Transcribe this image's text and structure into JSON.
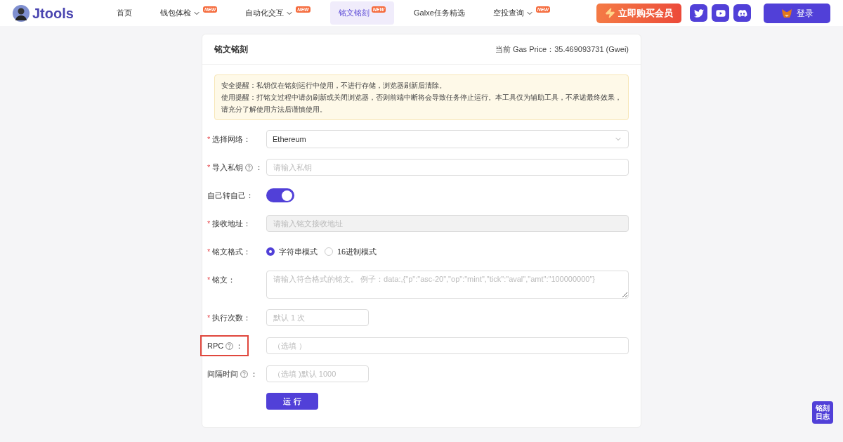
{
  "brand": {
    "name": "Jtools"
  },
  "nav": [
    {
      "label": "首页",
      "dropdown": false,
      "selected": false
    },
    {
      "label": "钱包体检",
      "dropdown": true,
      "new_badge": "NEW",
      "selected": false
    },
    {
      "label": "自动化交互",
      "dropdown": true,
      "new_badge": "NEW",
      "selected": false
    },
    {
      "label": "铭文铭刻",
      "dropdown": false,
      "new_badge": "NEW",
      "selected": true
    },
    {
      "label": "Galxe任务精选",
      "dropdown": false,
      "selected": false
    },
    {
      "label": "空投查询",
      "dropdown": true,
      "new_badge": "NEW",
      "selected": false
    }
  ],
  "buy_button": "立即购买会员",
  "social": [
    {
      "kind": "twitter"
    },
    {
      "kind": "youtube"
    },
    {
      "kind": "discord"
    }
  ],
  "login_button": "登录",
  "card": {
    "title": "铭文铭刻",
    "gas_price": "当前 Gas Price：35.469093731 (Gwei)",
    "notice": [
      "安全提醒：私钥仅在铭刻运行中使用，不进行存储，浏览器刷新后清除。",
      "使用提醒：打铭文过程中请勿刷新或关闭浏览器，否则前端中断将会导致任务停止运行。本工具仅为辅助工具，不承诺最终效果，请充分了解使用方法后谨慎使用。"
    ],
    "fields": [
      {
        "kind": "select",
        "required_mark": "*",
        "label": "选择网络",
        "colon": "：",
        "help": false,
        "highlighted": false,
        "value": "Ethereum"
      },
      {
        "kind": "input",
        "required_mark": "*",
        "label": "导入私钥",
        "colon": "：",
        "help": true,
        "highlighted": false,
        "placeholder": "请输入私钥",
        "short": false,
        "disabled": false
      },
      {
        "kind": "toggle",
        "label": "自己转自己",
        "colon": "：",
        "help": false,
        "highlighted": false,
        "on": true
      },
      {
        "kind": "input",
        "required_mark": "*",
        "label": "接收地址",
        "colon": "：",
        "help": false,
        "highlighted": false,
        "placeholder": "请输入铭文接收地址",
        "short": false,
        "disabled": true
      },
      {
        "kind": "radio",
        "required_mark": "*",
        "label": "铭文格式",
        "colon": "：",
        "help": false,
        "highlighted": false,
        "options": [
          {
            "label": "字符串模式",
            "selected": true
          },
          {
            "label": "16进制模式",
            "selected": false
          }
        ]
      },
      {
        "kind": "textarea",
        "required_mark": "*",
        "label": "铭文",
        "colon": "：",
        "help": false,
        "highlighted": false,
        "placeholder": "请输入符合格式的铭文。 例子：data:,{\"p\":\"asc-20\",\"op\":\"mint\",\"tick\":\"aval\",\"amt\":\"100000000\"}"
      },
      {
        "kind": "input",
        "required_mark": "*",
        "label": "执行次数",
        "colon": "：",
        "help": false,
        "highlighted": false,
        "placeholder": "默认 1 次",
        "short": true,
        "disabled": false
      },
      {
        "kind": "input",
        "label": "RPC",
        "colon": "：",
        "help": true,
        "highlighted": true,
        "placeholder": "（选填 ）",
        "short": false,
        "disabled": false
      },
      {
        "kind": "input",
        "label": "间隔时间",
        "colon": "：",
        "help": true,
        "highlighted": false,
        "placeholder": "（选填 )默认 1000",
        "short": true,
        "disabled": false
      }
    ],
    "submit_button": "运 行"
  },
  "log_button": "铭刻日志"
}
